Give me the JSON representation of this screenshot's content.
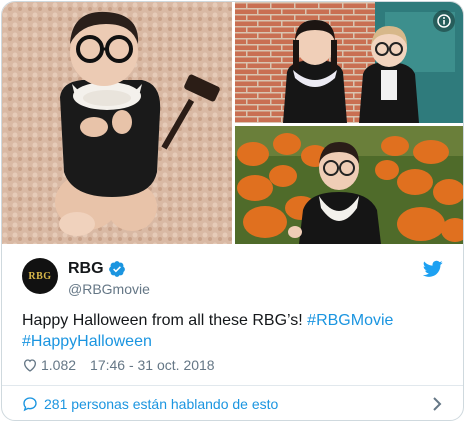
{
  "author": {
    "display_name": "RBG",
    "handle": "@RBGmovie",
    "avatar_text": "RBG",
    "verified": true
  },
  "tweet": {
    "text_plain": "Happy Halloween from all these RBG’s! ",
    "hashtags": [
      "#RBGMovie",
      "#HappyHalloween"
    ]
  },
  "meta": {
    "likes": "1.082",
    "timestamp": "17:46 - 31 oct. 2018"
  },
  "footer": {
    "talking_label": "281 personas están hablando de esto"
  },
  "icons": {
    "info": "info-icon",
    "verified": "verified-badge-icon",
    "brand": "twitter-bird-icon",
    "like": "heart-icon",
    "reply": "speech-bubble-icon",
    "more": "chevron-right-icon"
  },
  "colors": {
    "accent": "#1b95e0",
    "secondary_text": "#657786",
    "border": "#cfd9de"
  }
}
